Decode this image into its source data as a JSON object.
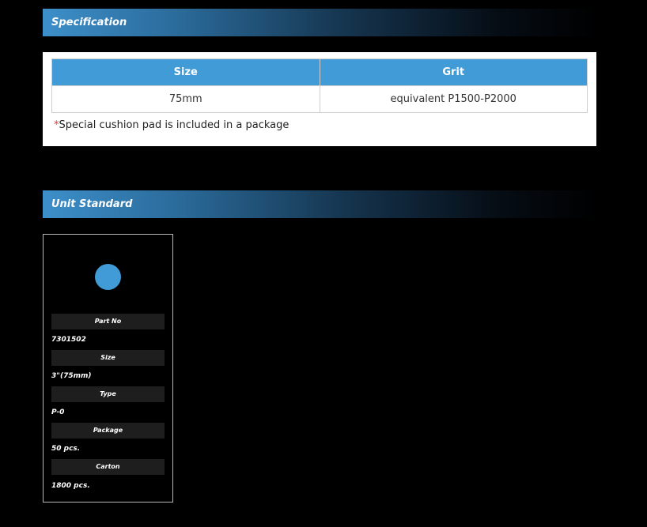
{
  "specification": {
    "title": "Specification",
    "table": {
      "headers": [
        "Size",
        "Grit"
      ],
      "rows": [
        [
          "75mm",
          "equivalent P1500-P2000"
        ]
      ]
    },
    "note_asterisk": "*",
    "note": "Special cushion pad is included in a package"
  },
  "unit_standard": {
    "title": "Unit Standard",
    "product_color": "#409bd7",
    "fields": [
      {
        "label": "Part No",
        "value": "7301502"
      },
      {
        "label": "Size",
        "value": "3\"(75mm)"
      },
      {
        "label": "Type",
        "value": "P-0"
      },
      {
        "label": "Package",
        "value": "50 pcs."
      },
      {
        "label": "Carton",
        "value": "1800 pcs."
      }
    ]
  },
  "colors": {
    "accent": "#409bd7",
    "background": "#000000",
    "label_background": "#1e1e1e",
    "note_asterisk": "#e03a3a"
  }
}
